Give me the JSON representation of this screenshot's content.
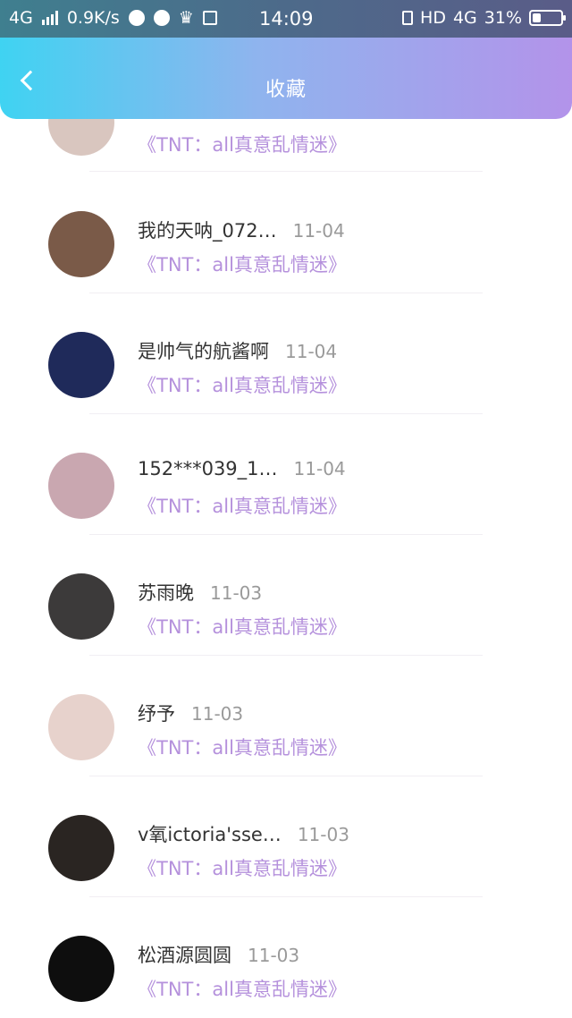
{
  "status_bar": {
    "network": "4G",
    "speed": "0.9K/s",
    "time": "14:09",
    "hd": "HD",
    "network2": "4G",
    "battery": "31%",
    "battery_level": 0.31
  },
  "header": {
    "title": "收藏"
  },
  "items": [
    {
      "name": "",
      "time": "",
      "subtitle": "《TNT：all真意乱情迷》",
      "avatar_color": "#d9c6bf"
    },
    {
      "name": "我的天呐_072…",
      "time": "11-04",
      "subtitle": "《TNT：all真意乱情迷》",
      "avatar_color": "#7a5a48"
    },
    {
      "name": "是帅气的航酱啊",
      "time": "11-04",
      "subtitle": "《TNT：all真意乱情迷》",
      "avatar_color": "#1f2a5a"
    },
    {
      "name": "152***039_1…",
      "time": "11-04",
      "subtitle": "《TNT：all真意乱情迷》",
      "avatar_color": "#c9a7b0"
    },
    {
      "name": "苏雨晚",
      "time": "11-03",
      "subtitle": "《TNT：all真意乱情迷》",
      "avatar_color": "#3c3a3a"
    },
    {
      "name": "纾予",
      "time": "11-03",
      "subtitle": "《TNT：all真意乱情迷》",
      "avatar_color": "#e7d2cc"
    },
    {
      "name": "v氧ictoria'sse…",
      "time": "11-03",
      "subtitle": "《TNT：all真意乱情迷》",
      "avatar_color": "#2a2522"
    },
    {
      "name": "松酒源圆圆",
      "time": "11-03",
      "subtitle": "《TNT：all真意乱情迷》",
      "avatar_color": "#0e0e0e"
    }
  ]
}
